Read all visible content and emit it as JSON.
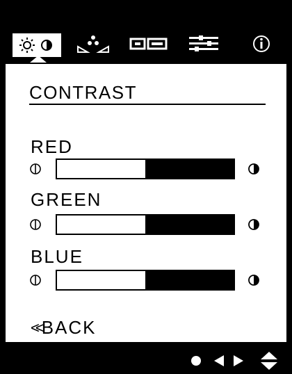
{
  "tabs": [
    {
      "name": "brightness-contrast",
      "active": true
    },
    {
      "name": "color-balance",
      "active": false
    },
    {
      "name": "display-size",
      "active": false
    },
    {
      "name": "settings",
      "active": false
    },
    {
      "name": "information",
      "active": false
    }
  ],
  "menu": {
    "title": "CONTRAST",
    "sliders": [
      {
        "label": "RED",
        "value_percent": 50
      },
      {
        "label": "GREEN",
        "value_percent": 50
      },
      {
        "label": "BLUE",
        "value_percent": 50
      }
    ],
    "back_label": "BACK",
    "back_glyph": "<<"
  },
  "colors": {
    "background": "#000000",
    "panel": "#ffffff",
    "ink": "#000000"
  }
}
